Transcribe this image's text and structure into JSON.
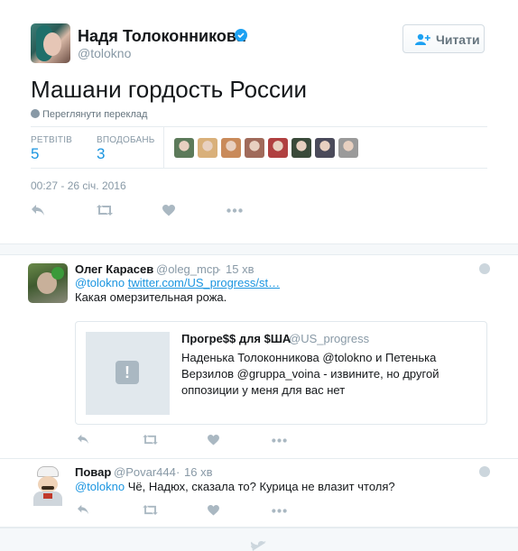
{
  "main_tweet": {
    "author_name": "Надя Толоконникова",
    "author_handle": "@tolokno",
    "follow_label": "Читати",
    "text": "Машани гордость России",
    "translate_label": "Переглянути переклад",
    "retweets_label": "РЕТВІТІВ",
    "retweets_count": "5",
    "likes_label": "ВПОДОБАНЬ",
    "likes_count": "3",
    "timestamp": "00:27 - 26 січ. 2016",
    "liker_avatar_colors": [
      "#5c7a5a",
      "#d9b07a",
      "#c98a5a",
      "#a06a5a",
      "#b04040",
      "#3a4a3a",
      "#4a4a5a",
      "#9a9a9a"
    ]
  },
  "replies": [
    {
      "author_name": "Олег Карасев",
      "author_handle": "@oleg_mcp",
      "time": "15 хв",
      "mention": "@tolokno",
      "link": "twitter.com/US_progress/st…",
      "text": "Какая омерзительная рожа.",
      "quote": {
        "author_name": "Прогре$$ для $ША",
        "author_handle": "@US_progress",
        "lines": [
          "Наденька Толоконникова @tolokno и Петенька",
          "Верзилов @gruppa_voina - извините, но другой",
          "оппозиции у меня для вас нет"
        ]
      }
    },
    {
      "author_name": "Повар",
      "author_handle": "@Povar444",
      "time": "16 хв",
      "mention": "@tolokno",
      "text": "Чё, Надюх, сказала то? Курица не влазит чтоля?"
    }
  ],
  "colors": {
    "link": "#1b95e0",
    "verified": "#1da1f2",
    "muted": "#8899a6",
    "action_icon": "#aab8c2"
  }
}
